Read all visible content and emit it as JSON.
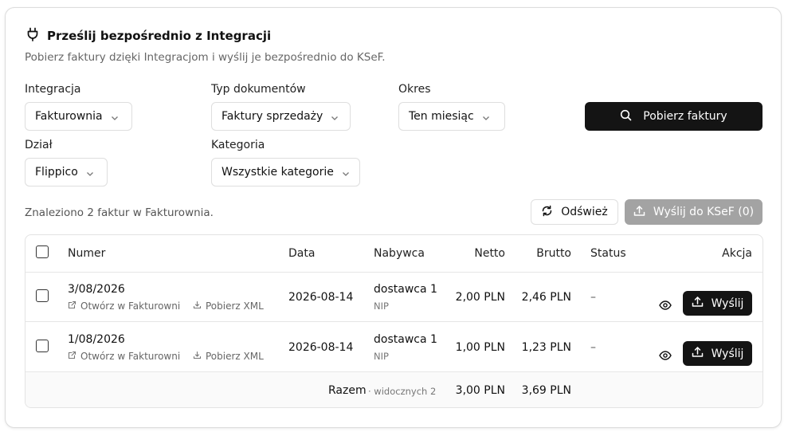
{
  "header": {
    "title": "Prześlij bezpośrednio z Integracji",
    "subtitle": "Pobierz faktury dzięki Integracjom i wyślij je bezpośrednio do KSeF."
  },
  "filters": {
    "integration": {
      "label": "Integracja",
      "value": "Fakturownia"
    },
    "doc_type": {
      "label": "Typ dokumentów",
      "value": "Faktury sprzedaży"
    },
    "period": {
      "label": "Okres",
      "value": "Ten miesiąc"
    },
    "department": {
      "label": "Dział",
      "value": "Flippico"
    },
    "category": {
      "label": "Kategoria",
      "value": "Wszystkie kategorie"
    },
    "fetch_button": "Pobierz faktury"
  },
  "results": {
    "found_text": "Znaleziono 2 faktur w Fakturownia.",
    "refresh_button": "Odśwież",
    "send_all_button": "Wyślij do KSeF (0)"
  },
  "table": {
    "headers": {
      "number": "Numer",
      "date": "Data",
      "buyer": "Nabywca",
      "net": "Netto",
      "gross": "Brutto",
      "status": "Status",
      "action": "Akcja"
    },
    "rows": [
      {
        "number": "3/08/2026",
        "open_link": "Otwórz w Fakturowni",
        "xml_link": "Pobierz XML",
        "date": "2026-08-14",
        "buyer": "dostawca 1",
        "buyer_sub": "NIP",
        "net": "2,00 PLN",
        "gross": "2,46 PLN",
        "status": "–",
        "send": "Wyślij"
      },
      {
        "number": "1/08/2026",
        "open_link": "Otwórz w Fakturowni",
        "xml_link": "Pobierz XML",
        "date": "2026-08-14",
        "buyer": "dostawca 1",
        "buyer_sub": "NIP",
        "net": "1,00 PLN",
        "gross": "1,23 PLN",
        "status": "–",
        "send": "Wyślij"
      }
    ],
    "footer": {
      "label": "Razem",
      "visible": "· widocznych 2",
      "net": "3,00 PLN",
      "gross": "3,69 PLN"
    }
  },
  "icons": {
    "plug": "plug-icon",
    "search": "search-icon",
    "refresh": "refresh-icon",
    "upload": "upload-icon",
    "eye": "eye-icon",
    "external": "external-link-icon",
    "download": "download-icon",
    "chevron": "chevron-down-icon"
  },
  "colors": {
    "primary": "#141414",
    "disabled": "#a3a3a3",
    "border": "#dedede"
  }
}
